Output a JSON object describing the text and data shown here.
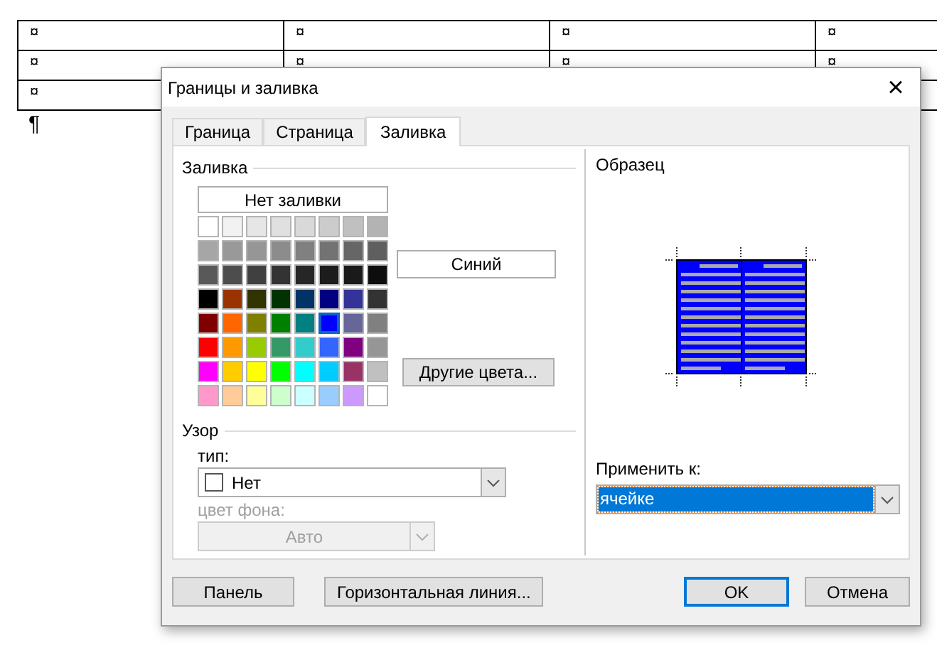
{
  "document": {
    "rows": [
      [
        "¤",
        "¤",
        "¤",
        "¤"
      ],
      [
        "¤",
        "¤",
        "¤",
        "¤"
      ],
      [
        "¤"
      ]
    ],
    "paragraph_mark": "¶"
  },
  "dialog": {
    "title": "Границы и заливка",
    "close": "×",
    "tabs": [
      {
        "label": "Граница",
        "selected": false
      },
      {
        "label": "Страница",
        "selected": false
      },
      {
        "label": "Заливка",
        "selected": true
      }
    ],
    "fill": {
      "heading": "Заливка",
      "no_fill": "Нет заливки",
      "color_name": "Синий",
      "more_colors": "Другие цвета...",
      "swatches": [
        {
          "color": "#ffffff",
          "selected": false
        },
        {
          "color": "#f2f2f2",
          "selected": false
        },
        {
          "color": "#e6e6e6",
          "selected": false
        },
        {
          "color": "#e0e0e0",
          "selected": false
        },
        {
          "color": "#d9d9d9",
          "selected": false
        },
        {
          "color": "#cccccc",
          "selected": false
        },
        {
          "color": "#c0c0c0",
          "selected": false
        },
        {
          "color": "#b3b3b3",
          "selected": false
        },
        {
          "color": "#a6a6a6",
          "selected": false
        },
        {
          "color": "#999999",
          "selected": false
        },
        {
          "color": "#969696",
          "selected": false
        },
        {
          "color": "#8c8c8c",
          "selected": false
        },
        {
          "color": "#808080",
          "selected": false
        },
        {
          "color": "#737373",
          "selected": false
        },
        {
          "color": "#666666",
          "selected": false
        },
        {
          "color": "#5f5f5f",
          "selected": false
        },
        {
          "color": "#595959",
          "selected": false
        },
        {
          "color": "#4d4d4d",
          "selected": false
        },
        {
          "color": "#404040",
          "selected": false
        },
        {
          "color": "#333333",
          "selected": false
        },
        {
          "color": "#262626",
          "selected": false
        },
        {
          "color": "#1c1c1c",
          "selected": false
        },
        {
          "color": "#1a1a1a",
          "selected": false
        },
        {
          "color": "#0d0d0d",
          "selected": false
        },
        {
          "color": "#000000",
          "selected": false
        },
        {
          "color": "#993300",
          "selected": false
        },
        {
          "color": "#333300",
          "selected": false
        },
        {
          "color": "#003300",
          "selected": false
        },
        {
          "color": "#003366",
          "selected": false
        },
        {
          "color": "#000080",
          "selected": false
        },
        {
          "color": "#333399",
          "selected": false
        },
        {
          "color": "#333333",
          "selected": false
        },
        {
          "color": "#800000",
          "selected": false
        },
        {
          "color": "#ff6600",
          "selected": false
        },
        {
          "color": "#808000",
          "selected": false
        },
        {
          "color": "#008000",
          "selected": false
        },
        {
          "color": "#008080",
          "selected": false
        },
        {
          "color": "#0000ff",
          "selected": true
        },
        {
          "color": "#666699",
          "selected": false
        },
        {
          "color": "#808080",
          "selected": false
        },
        {
          "color": "#ff0000",
          "selected": false
        },
        {
          "color": "#ff9900",
          "selected": false
        },
        {
          "color": "#99cc00",
          "selected": false
        },
        {
          "color": "#339966",
          "selected": false
        },
        {
          "color": "#33cccc",
          "selected": false
        },
        {
          "color": "#3366ff",
          "selected": false
        },
        {
          "color": "#800080",
          "selected": false
        },
        {
          "color": "#969696",
          "selected": false
        },
        {
          "color": "#ff00ff",
          "selected": false
        },
        {
          "color": "#ffcc00",
          "selected": false
        },
        {
          "color": "#ffff00",
          "selected": false
        },
        {
          "color": "#00ff00",
          "selected": false
        },
        {
          "color": "#00ffff",
          "selected": false
        },
        {
          "color": "#00ccff",
          "selected": false
        },
        {
          "color": "#993366",
          "selected": false
        },
        {
          "color": "#c0c0c0",
          "selected": false
        },
        {
          "color": "#ff99cc",
          "selected": false
        },
        {
          "color": "#ffcc99",
          "selected": false
        },
        {
          "color": "#ffff99",
          "selected": false
        },
        {
          "color": "#ccffcc",
          "selected": false
        },
        {
          "color": "#ccffff",
          "selected": false
        },
        {
          "color": "#99ccff",
          "selected": false
        },
        {
          "color": "#cc99ff",
          "selected": false
        },
        {
          "color": "#ffffff",
          "selected": false
        }
      ]
    },
    "pattern": {
      "heading": "Узор",
      "type_label": "тип:",
      "type_value": "Нет",
      "bg_label": "цвет фона:",
      "bg_value": "Авто",
      "bg_disabled": true
    },
    "preview": {
      "heading": "Образец",
      "apply_label": "Применить к:",
      "apply_value": "ячейке"
    },
    "buttons": {
      "panel": "Панель",
      "horizontal_line": "Горизонтальная линия...",
      "ok": "OK",
      "cancel": "Отмена"
    }
  }
}
